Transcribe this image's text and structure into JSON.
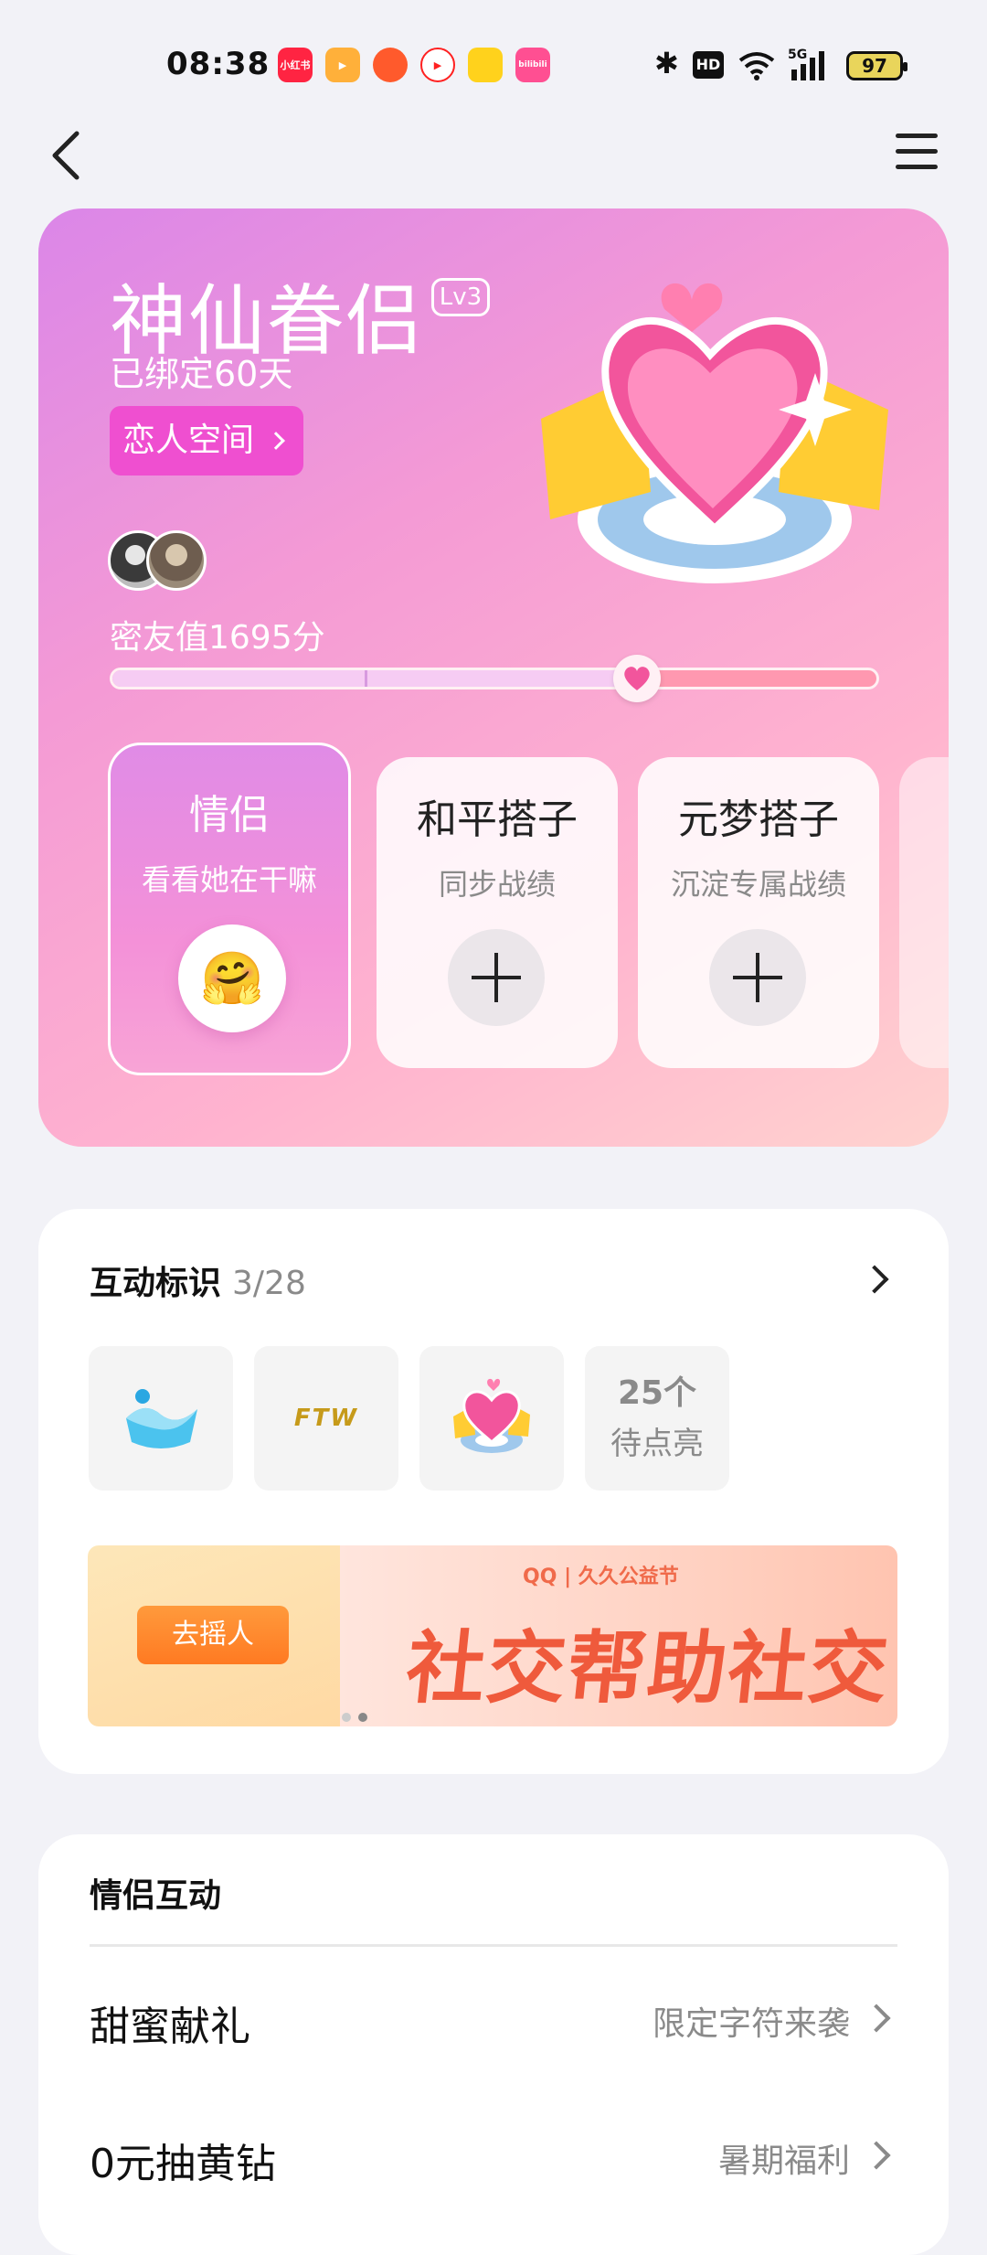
{
  "status_bar": {
    "time": "08:38",
    "apps": [
      {
        "name": "xiaohongshu-app-icon",
        "label": "小红书",
        "color": "#ff2442"
      },
      {
        "name": "video-app-icon",
        "label": "▶",
        "color": "#ffb03a"
      },
      {
        "name": "game-app-icon",
        "label": "",
        "color": "#ff5a2c"
      },
      {
        "name": "play-app-icon",
        "label": "▶",
        "color": "#ff2020"
      },
      {
        "name": "cat-app-icon",
        "label": "",
        "color": "#ffd21c"
      },
      {
        "name": "bilibili-app-icon",
        "label": "bilibili",
        "color": "#ff4f92"
      }
    ],
    "battery": "97"
  },
  "hero": {
    "title": "神仙眷侣",
    "level": "Lv3",
    "bound_days": "已绑定60天",
    "space_button": "恋人空间",
    "intimacy": "密友值1695分",
    "progress": 0.69
  },
  "tags": [
    {
      "title": "情侣",
      "subtitle": "看看她在干嘛",
      "emoji": "🤗"
    },
    {
      "title": "和平搭子",
      "subtitle": "同步战绩"
    },
    {
      "title": "元梦搭子",
      "subtitle": "沉淀专属战绩"
    }
  ],
  "interaction_badges": {
    "title": "互动标识",
    "count": "3/28",
    "pending_count": "25个",
    "pending_label": "待点亮",
    "badge_text": "FTW"
  },
  "banner": {
    "button": "去摇人",
    "brand": "QQ | 久久公益节",
    "slogan": "社交帮助社交"
  },
  "couple_interaction": {
    "title": "情侣互动",
    "rows": [
      {
        "label": "甜蜜献礼",
        "value": "限定字符来袭"
      },
      {
        "label": "0元抽黄钻",
        "value": "暑期福利"
      }
    ]
  },
  "colors": {
    "accent": "#ef4fd0",
    "hero_gradient_start": "#db86e8",
    "hero_gradient_end": "#ffd3cf",
    "progress_track": "#ff98b0"
  }
}
